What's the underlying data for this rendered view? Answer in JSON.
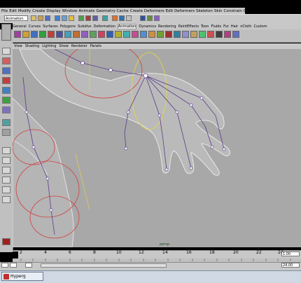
{
  "menubar": {
    "items": [
      "File",
      "Edit",
      "Modify",
      "Create",
      "Display",
      "Window",
      "Animate",
      "Geometry Cache",
      "Create Deformers",
      "Edit Deformers",
      "Skeleton",
      "Skin",
      "Constrain",
      "Character",
      "Help"
    ]
  },
  "status_line": {
    "mode": "Animation"
  },
  "shelf": {
    "tabs": [
      "General",
      "Curves",
      "Surfaces",
      "Polygons",
      "Subdivs",
      "Deformation",
      "Animation",
      "Dynamics",
      "Rendering",
      "PaintEffects",
      "Toon",
      "Fluids",
      "Fur",
      "Hair",
      "nCloth",
      "Custom"
    ],
    "active_tab": "Animation"
  },
  "panel_menu": {
    "items": [
      "View",
      "Shading",
      "Lighting",
      "Show",
      "Renderer",
      "Panels"
    ]
  },
  "viewport": {
    "camera_label": "persp"
  },
  "time_slider": {
    "ticks": [
      "2",
      "4",
      "6",
      "8",
      "10",
      "12",
      "14",
      "16",
      "18",
      "20",
      "22",
      "24"
    ],
    "current_frame": "1.00"
  },
  "range_slider": {
    "end_value": "24.00"
  },
  "taskbar": {
    "app_label": "Hyperg"
  },
  "colors": {
    "viewport_bg": "#a8a8a8",
    "ui_gray": "#c8c8c8",
    "joint": "#5a3a8a",
    "control_red": "#d04040",
    "control_yellow": "#e8d840"
  }
}
